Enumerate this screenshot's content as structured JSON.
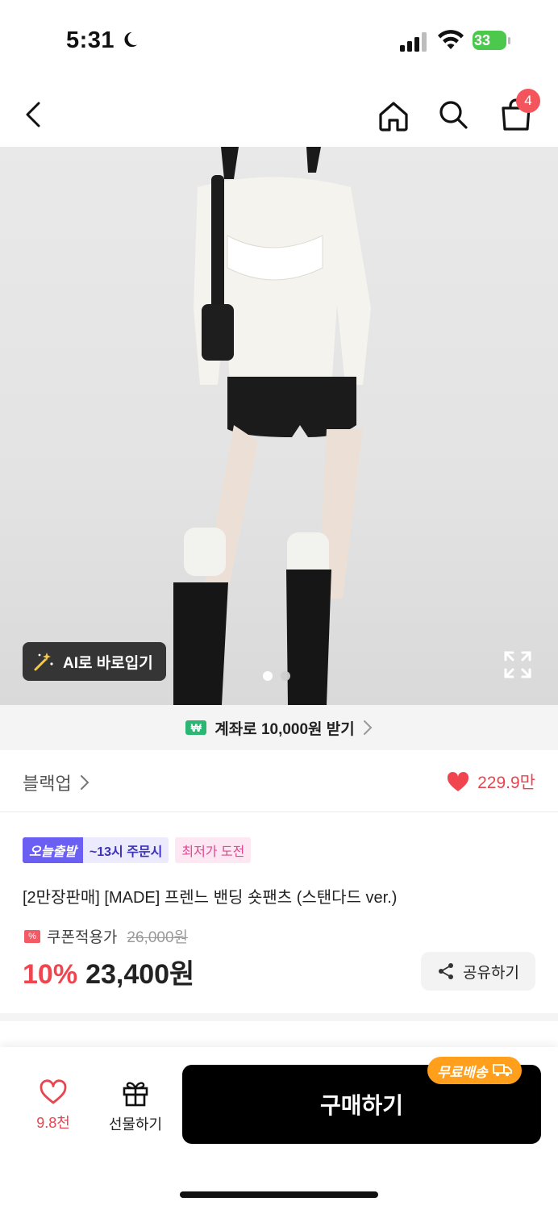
{
  "status_bar": {
    "time": "5:31",
    "battery": "33"
  },
  "nav": {
    "cart_count": "4"
  },
  "hero": {
    "ai_button": "AI로 바로입기",
    "page_indicator": {
      "current": 1,
      "total": 2
    }
  },
  "bank_banner": {
    "badge": "₩",
    "text": "계좌로 10,000원 받기"
  },
  "brand": {
    "name": "블랙업",
    "like_count": "229.9만"
  },
  "tags": [
    "오늘출발",
    "~13시 주문시",
    "최저가 도전"
  ],
  "product": {
    "title": "[2만장판매] [MADE] 프렌느 밴딩 숏팬츠 (스탠다드 ver.)",
    "coupon_label": "쿠폰적용가",
    "original_price": "26,000원",
    "discount": "10%",
    "price": "23,400원",
    "share_label": "공유하기"
  },
  "bottom_bar": {
    "wish_count": "9.8천",
    "gift_label": "선물하기",
    "buy_label": "구매하기",
    "free_shipping": "무료배송"
  },
  "colors": {
    "accent_red": "#f0454f",
    "buy_button": "#000000",
    "free_shipping": "#ff9f1c"
  }
}
